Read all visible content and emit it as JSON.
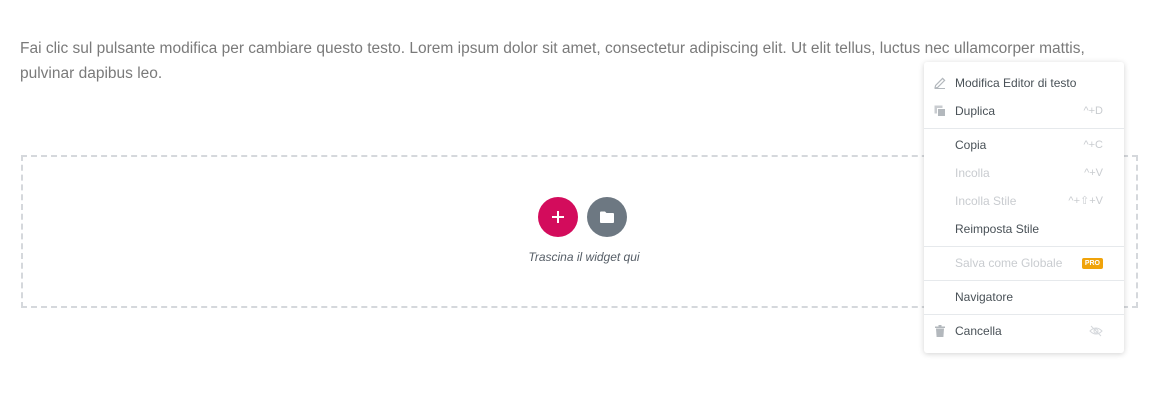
{
  "text_widget": {
    "content": "Fai clic sul pulsante modifica per cambiare questo testo. Lorem ipsum dolor sit amet, consectetur adipiscing elit. Ut elit tellus, luctus nec ullamcorper mattis, pulvinar dapibus leo."
  },
  "drop_zone": {
    "label": "Trascina il widget qui",
    "add_icon": "plus-icon",
    "template_icon": "folder-icon"
  },
  "context_menu": {
    "groups": [
      [
        {
          "label": "Modifica Editor di testo",
          "shortcut": "",
          "icon": "pencil-icon",
          "disabled": false
        },
        {
          "label": "Duplica",
          "shortcut": "^+D",
          "icon": "copy-icon",
          "disabled": false
        }
      ],
      [
        {
          "label": "Copia",
          "shortcut": "^+C",
          "icon": "",
          "disabled": false
        },
        {
          "label": "Incolla",
          "shortcut": "^+V",
          "icon": "",
          "disabled": true
        },
        {
          "label": "Incolla Stile",
          "shortcut": "^+⇧+V",
          "icon": "",
          "disabled": true
        },
        {
          "label": "Reimposta Stile",
          "shortcut": "",
          "icon": "",
          "disabled": false
        }
      ],
      [
        {
          "label": "Salva come Globale",
          "badge": "PRO",
          "icon": "",
          "disabled": true
        }
      ],
      [
        {
          "label": "Navigatore",
          "shortcut": "",
          "icon": "",
          "disabled": false
        }
      ],
      [
        {
          "label": "Cancella",
          "shortcut": "",
          "icon": "trash-icon",
          "trailing_icon": "eye-slash-icon",
          "disabled": false
        }
      ]
    ]
  },
  "colors": {
    "add_button": "#d30c5c",
    "folder_button": "#6d7882",
    "text": "#7a7a7a",
    "menu_text": "#495157",
    "menu_disabled": "#c9ccd0",
    "pro_badge": "#f0a30a"
  }
}
